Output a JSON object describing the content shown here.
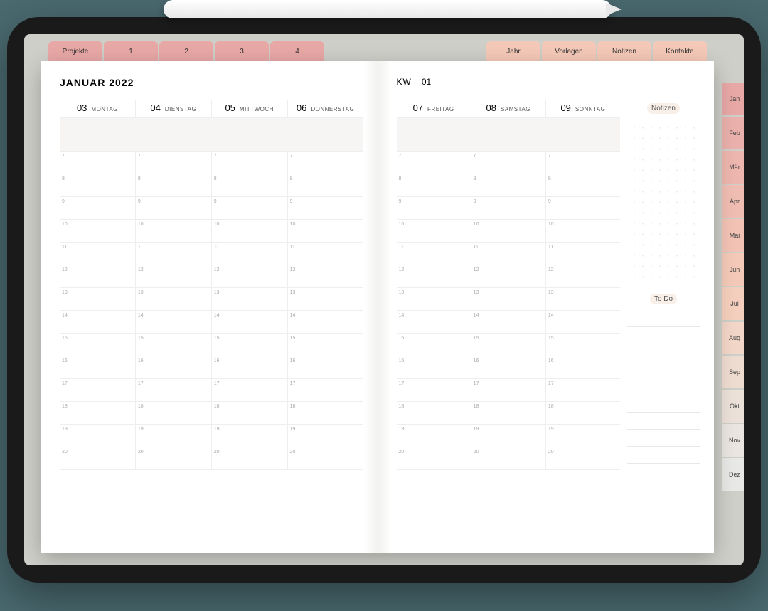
{
  "topTabs": {
    "left": [
      "Projekte",
      "1",
      "2",
      "3",
      "4"
    ],
    "right": [
      "Jahr",
      "Vorlagen",
      "Notizen",
      "Kontakte"
    ]
  },
  "sideTabs": [
    {
      "label": "Jan",
      "color": "#e8a8a6"
    },
    {
      "label": "Feb",
      "color": "#eab0ab"
    },
    {
      "label": "Mär",
      "color": "#edb6ae"
    },
    {
      "label": "Apr",
      "color": "#f0bdb2"
    },
    {
      "label": "Mai",
      "color": "#f2c3b5"
    },
    {
      "label": "Jun",
      "color": "#f4c9b8"
    },
    {
      "label": "Jul",
      "color": "#f5cfbd"
    },
    {
      "label": "Aug",
      "color": "#f2d6c7"
    },
    {
      "label": "Sep",
      "color": "#efdcd0"
    },
    {
      "label": "Okt",
      "color": "#ece1d8"
    },
    {
      "label": "Nov",
      "color": "#eae5e0"
    },
    {
      "label": "Dez",
      "color": "#e8e8e6"
    }
  ],
  "leftPage": {
    "title": "JANUAR 2022",
    "days": [
      {
        "num": "03",
        "name": "MONTAG"
      },
      {
        "num": "04",
        "name": "DIENSTAG"
      },
      {
        "num": "05",
        "name": "MITTWOCH"
      },
      {
        "num": "06",
        "name": "DONNERSTAG"
      }
    ]
  },
  "rightPage": {
    "kwLabel": "KW",
    "kwNum": "01",
    "days": [
      {
        "num": "07",
        "name": "FREITAG"
      },
      {
        "num": "08",
        "name": "SAMSTAG"
      },
      {
        "num": "09",
        "name": "SONNTAG"
      }
    ],
    "notesLabel": "Notizen",
    "todoLabel": "To Do"
  },
  "hours": [
    "7",
    "8",
    "9",
    "10",
    "11",
    "12",
    "13",
    "14",
    "15",
    "16",
    "17",
    "18",
    "19",
    "20"
  ]
}
